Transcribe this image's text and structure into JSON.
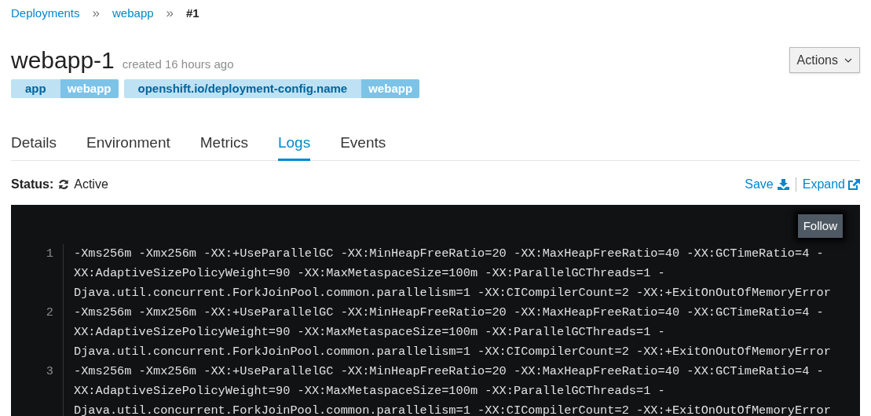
{
  "breadcrumb": [
    {
      "label": "Deployments",
      "link": true
    },
    {
      "label": "webapp",
      "link": true
    },
    {
      "label": "#1",
      "link": false
    }
  ],
  "breadcrumb_separator": "»",
  "title": "webapp-1",
  "subtitle": "created 16 hours ago",
  "actions_button": "Actions",
  "labels": [
    {
      "key": "app",
      "value": "webapp"
    },
    {
      "key": "openshift.io/deployment-config.name",
      "value": "webapp"
    }
  ],
  "tabs": [
    {
      "label": "Details",
      "selected": false
    },
    {
      "label": "Environment",
      "selected": false
    },
    {
      "label": "Metrics",
      "selected": false
    },
    {
      "label": "Logs",
      "selected": true
    },
    {
      "label": "Events",
      "selected": false
    }
  ],
  "status": {
    "label": "Status:",
    "value": "Active"
  },
  "log_actions": {
    "save": "Save",
    "expand": "Expand"
  },
  "follow_button": "Follow",
  "log_entries": [
    {
      "number": "1",
      "lines": [
        "-Xms256m -Xmx256m -XX:+UseParallelGC -XX:MinHeapFreeRatio=20 -XX:MaxHeapFreeRatio=40 -XX:GCTimeRatio=4 -",
        "XX:AdaptiveSizePolicyWeight=90 -XX:MaxMetaspaceSize=100m -XX:ParallelGCThreads=1 -",
        "Djava.util.concurrent.ForkJoinPool.common.parallelism=1 -XX:CICompilerCount=2 -XX:+ExitOnOutOfMemoryError"
      ]
    },
    {
      "number": "2",
      "lines": [
        "-Xms256m -Xmx256m -XX:+UseParallelGC -XX:MinHeapFreeRatio=20 -XX:MaxHeapFreeRatio=40 -XX:GCTimeRatio=4 -",
        "XX:AdaptiveSizePolicyWeight=90 -XX:MaxMetaspaceSize=100m -XX:ParallelGCThreads=1 -",
        "Djava.util.concurrent.ForkJoinPool.common.parallelism=1 -XX:CICompilerCount=2 -XX:+ExitOnOutOfMemoryError"
      ]
    },
    {
      "number": "3",
      "lines": [
        "-Xms256m -Xmx256m -XX:+UseParallelGC -XX:MinHeapFreeRatio=20 -XX:MaxHeapFreeRatio=40 -XX:GCTimeRatio=4 -",
        "XX:AdaptiveSizePolicyWeight=90 -XX:MaxMetaspaceSize=100m -XX:ParallelGCThreads=1 -",
        "Djava.util.concurrent.ForkJoinPool.common.parallelism=1 -XX:CICompilerCount=2 -XX:+ExitOnOutOfMemoryError"
      ]
    }
  ]
}
